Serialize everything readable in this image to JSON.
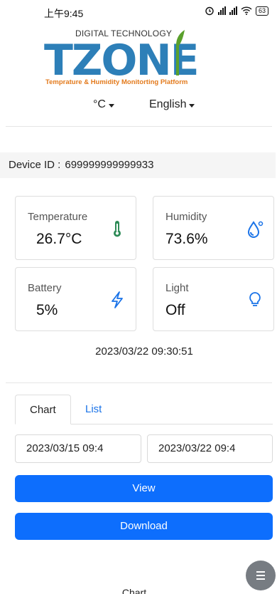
{
  "status_bar": {
    "time": "上午9:45",
    "battery": "63"
  },
  "logo": {
    "tagline_top": "DIGITAL TECHNOLOGY",
    "wordmark": "TZONE",
    "tagline_bottom": "Temprature & Humidity Monitorting Platform"
  },
  "selectors": {
    "unit": "°C",
    "language": "English"
  },
  "device": {
    "label": "Device ID :",
    "id": "699999999999933"
  },
  "cards": {
    "temperature": {
      "title": "Temperature",
      "value": "26.7°C",
      "icon": "thermometer-icon",
      "color": "#2e8b57"
    },
    "humidity": {
      "title": "Humidity",
      "value": "73.6%",
      "icon": "water-drop-icon",
      "color": "#1a73e8"
    },
    "battery": {
      "title": "Battery",
      "value": "5%",
      "icon": "lightning-icon",
      "color": "#1a73e8"
    },
    "light": {
      "title": "Light",
      "value": "Off",
      "icon": "lightbulb-icon",
      "color": "#1a73e8"
    }
  },
  "timestamp": "2023/03/22 09:30:51",
  "tabs": {
    "chart": "Chart",
    "list": "List"
  },
  "range": {
    "start": "2023/03/15 09:4",
    "end": "2023/03/22 09:4"
  },
  "buttons": {
    "view": "View",
    "download": "Download"
  },
  "bottom_label": "Chart",
  "colors": {
    "primary": "#0d6efd",
    "link": "#1a73e8",
    "brand_blue": "#2d7fb8",
    "brand_orange": "#e37a1c",
    "brand_green": "#5aa02c"
  }
}
